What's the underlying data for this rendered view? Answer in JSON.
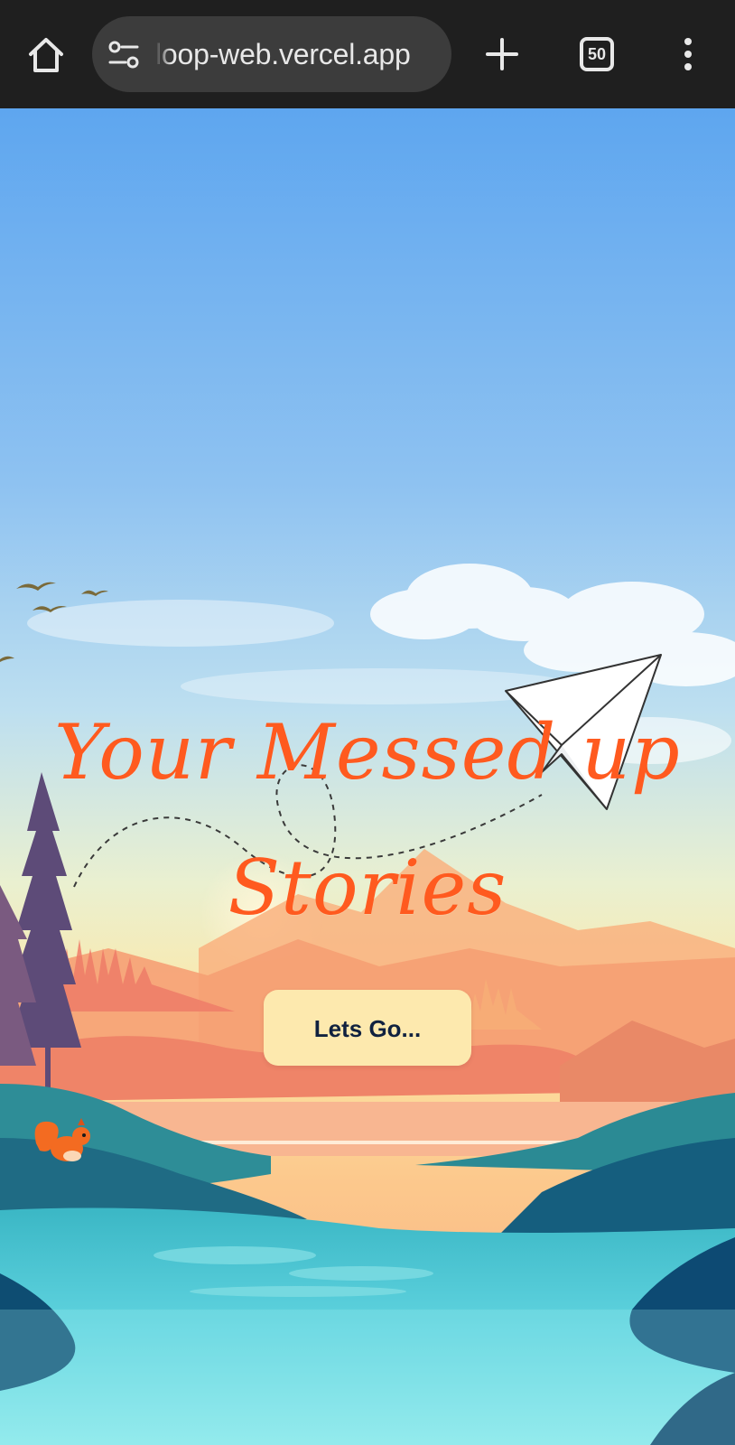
{
  "browser": {
    "url": "loop-web.vercel.app",
    "tab_count": "50",
    "icons": {
      "home": "home-icon",
      "site_settings": "tune-icon",
      "new_tab": "plus-icon",
      "tabs": "tab-switcher-icon",
      "menu": "more-vertical-icon"
    }
  },
  "hero": {
    "title_line1": "Your Messed up",
    "title_line2": "Stories",
    "cta_label": "Lets Go...",
    "title_color": "#ff5a1f",
    "cta_background": "#fde9ae",
    "cta_text_color": "#10213f"
  },
  "illustration": {
    "description_icons": [
      "paper-plane-icon",
      "squirrel-icon",
      "bird-icon"
    ]
  }
}
